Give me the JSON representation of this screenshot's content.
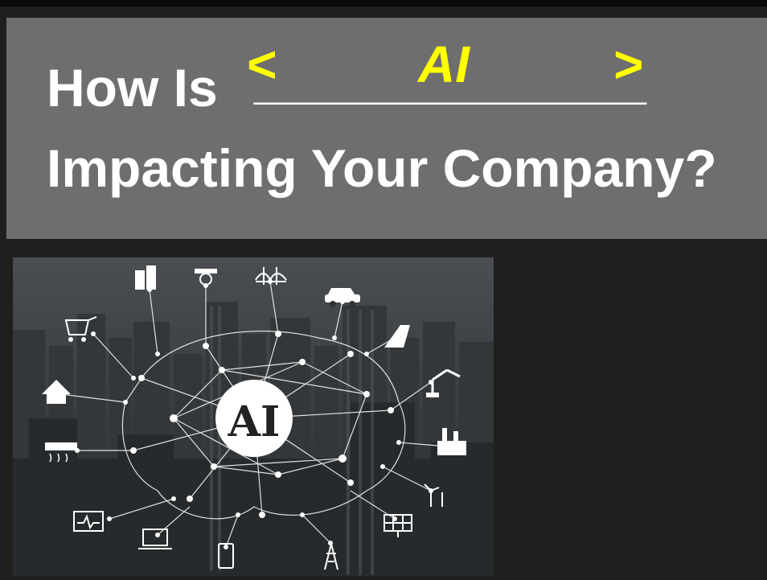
{
  "title": {
    "line1_prefix": "How Is",
    "blank": "______________",
    "fill_open": "<",
    "fill_word": "AI",
    "fill_close": ">",
    "line2": "Impacting Your Company?"
  },
  "image": {
    "center_label": "AI",
    "icons": [
      "office-building-icon",
      "security-camera-icon",
      "bridge-icon",
      "car-icon",
      "shopping-cart-icon",
      "road-icon",
      "robot-arm-icon",
      "house-icon",
      "factory-icon",
      "air-conditioner-icon",
      "wind-turbine-icon",
      "heart-monitor-icon",
      "laptop-icon",
      "smartphone-icon",
      "power-tower-icon",
      "solar-panel-icon"
    ]
  },
  "colors": {
    "background": "#1f1f1d",
    "title_band": "#6e6e6e",
    "title_text": "#ffffff",
    "highlight": "#ffff00"
  }
}
